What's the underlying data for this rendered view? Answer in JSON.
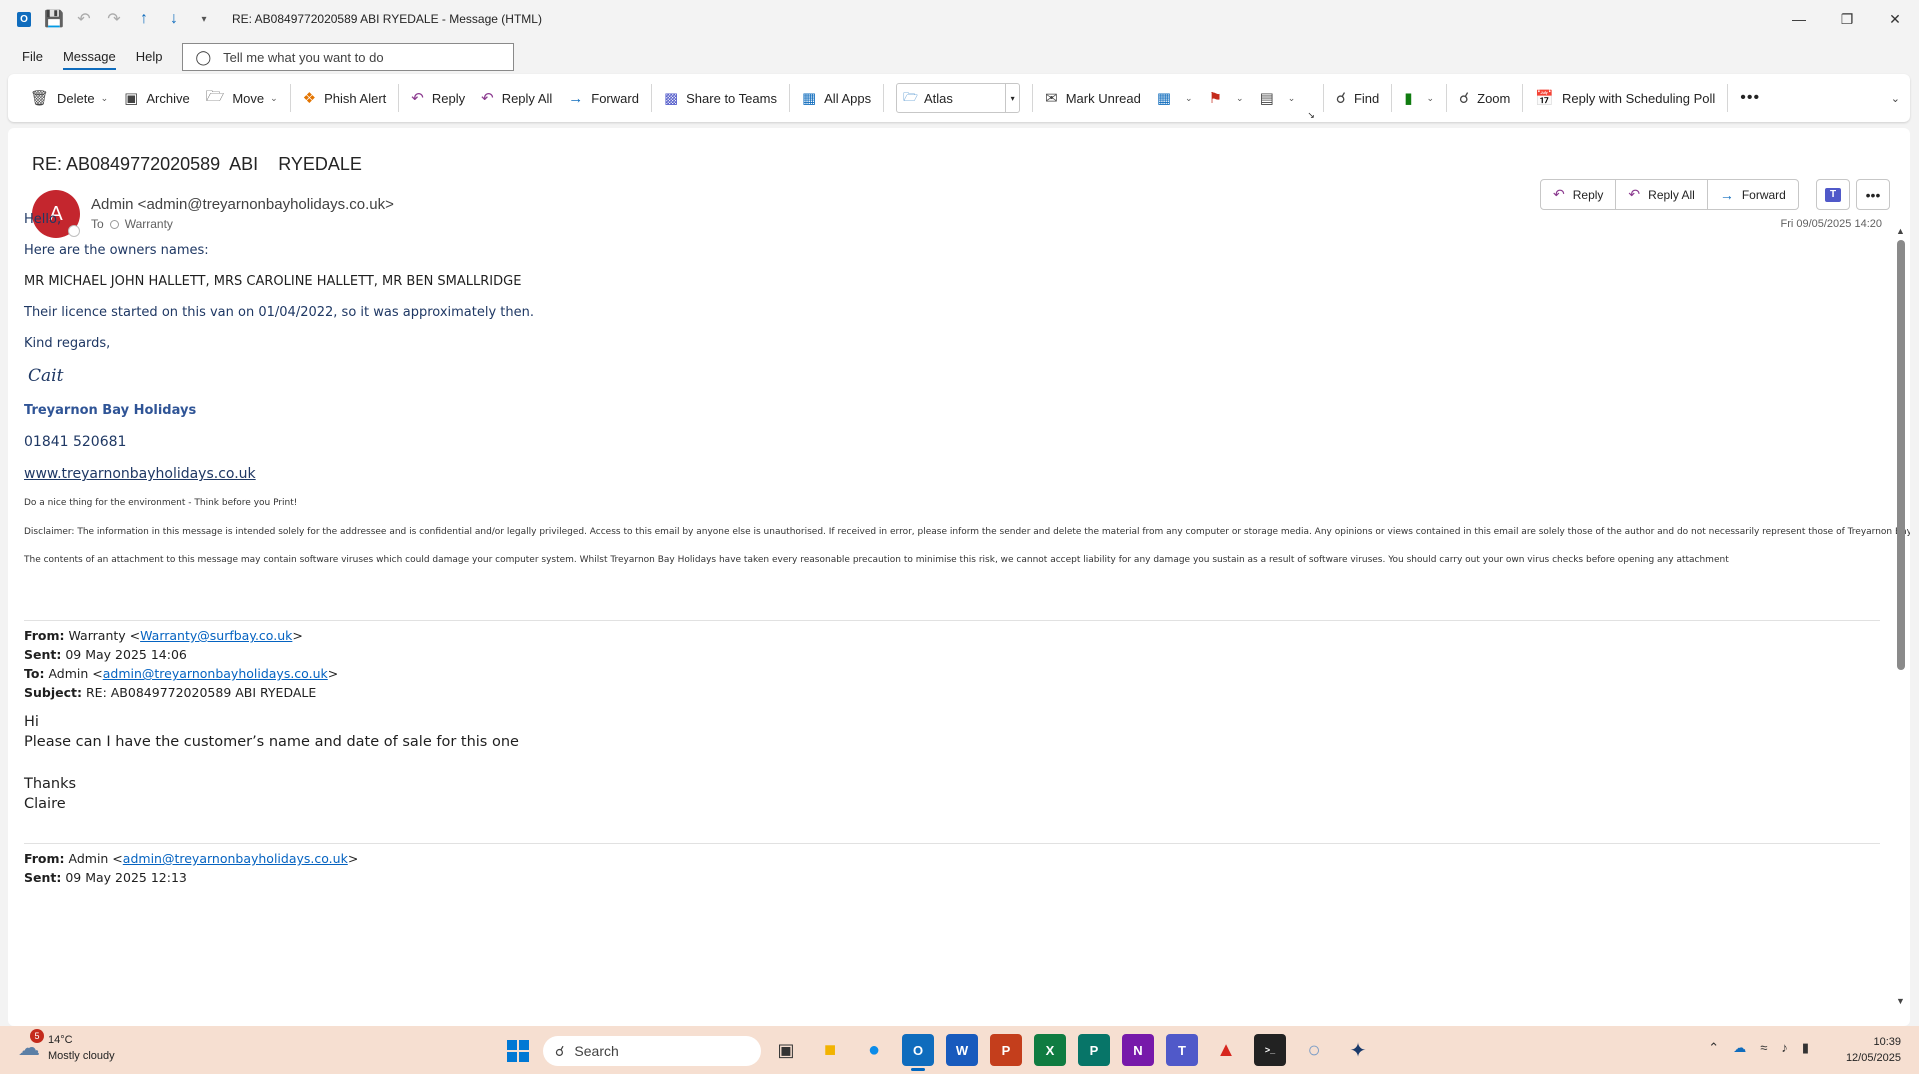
{
  "window": {
    "title": "RE: AB0849772020589 ABI RYEDALE  -  Message (HTML)"
  },
  "menu": {
    "file": "File",
    "message": "Message",
    "help": "Help",
    "tellme_placeholder": "Tell me what you want to do"
  },
  "ribbon": {
    "delete": "Delete",
    "archive": "Archive",
    "move": "Move",
    "phish_alert": "Phish Alert",
    "reply": "Reply",
    "reply_all": "Reply All",
    "forward": "Forward",
    "share_to_teams": "Share to Teams",
    "all_apps": "All Apps",
    "atlas": "Atlas",
    "mark_unread": "Mark Unread",
    "find": "Find",
    "zoom": "Zoom",
    "reply_scheduling_poll": "Reply with Scheduling Poll"
  },
  "email": {
    "subject": "RE: AB0849772020589  ABI    RYEDALE",
    "avatar_initial": "A",
    "sender": "Admin <admin@treyarnonbayholidays.co.uk>",
    "to_label": "To",
    "to_value": "Warranty",
    "date": "Fri 09/05/2025 14:20",
    "actions": {
      "reply": "Reply",
      "reply_all": "Reply All",
      "forward": "Forward"
    },
    "body": {
      "greeting": "Hello,",
      "intro": "Here are the owners names:",
      "owners": "MR MICHAEL JOHN HALLETT, MRS CAROLINE HALLETT, MR BEN SMALLRIDGE",
      "licence": "Their licence started on this van on 01/04/2022, so it was approximately then.",
      "regards": "Kind regards,",
      "signature": "Cait",
      "company": "Treyarnon Bay Holidays",
      "phone": "01841 520681",
      "website": "www.treyarnonbayholidays.co.uk",
      "env_note": "Do a nice thing for the environment - Think before you Print!",
      "disclaimer": "Disclaimer: The information in this message is intended solely for the addressee and is confidential and/or legally privileged. Access to this email by anyone else is unauthorised. If received in error, please inform the sender and delete the material from any computer or storage media. Any opinions or views contained in this email are solely those of the author and do not necessarily represent those of Treyarnon Bay Holidays.",
      "virus_note": "The contents of an attachment to this message may contain software viruses which could damage your computer system. Whilst Treyarnon Bay Holidays have taken every reasonable precaution to minimise this risk, we cannot accept liability for any damage you sustain as a result of software viruses. You should carry out your own virus checks before opening any attachment"
    },
    "quoted1": {
      "from_label": "From:",
      "from_name": "Warranty <",
      "from_email": "Warranty@surfbay.co.uk",
      "from_end": ">",
      "sent_label": "Sent:",
      "sent": "09 May 2025 14:06",
      "to_label": "To:",
      "to_name": "Admin <",
      "to_email": "admin@treyarnonbayholidays.co.uk",
      "to_end": ">",
      "subject_label": "Subject:",
      "subject": "RE: AB0849772020589 ABI RYEDALE",
      "hi": "Hi",
      "question": "Please can I have the customer’s name and date of sale for this one",
      "thanks": "Thanks",
      "name": "Claire"
    },
    "quoted2": {
      "from_label": "From:",
      "from_name": "Admin <",
      "from_email": "admin@treyarnonbayholidays.co.uk",
      "from_end": ">",
      "sent_label": "Sent:",
      "sent": "09 May 2025 12:13"
    }
  },
  "taskbar": {
    "weather_badge": "5",
    "temp": "14°C",
    "condition": "Mostly cloudy",
    "search": "Search",
    "time": "10:39",
    "date": "12/05/2025"
  }
}
